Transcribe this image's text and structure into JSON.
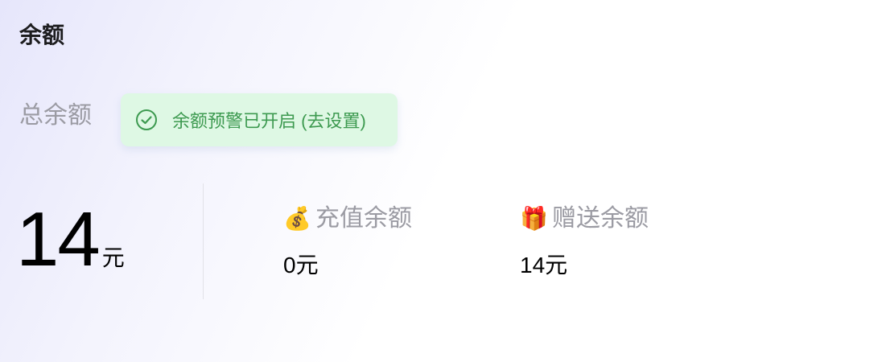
{
  "header": {
    "title": "余额"
  },
  "total": {
    "label": "总余额",
    "amount": "14",
    "unit": "元"
  },
  "alert": {
    "text": "余额预警已开启 (去设置)",
    "icon": "check-circle-icon",
    "color": "#3d9a50",
    "background": "#def8e4"
  },
  "recharge": {
    "icon": "money-bag-icon",
    "icon_glyph": "💰",
    "label": "充值余额",
    "value": "0元"
  },
  "gift": {
    "icon": "gift-icon",
    "icon_glyph": "🎁",
    "label": "赠送余额",
    "value": "14元"
  }
}
